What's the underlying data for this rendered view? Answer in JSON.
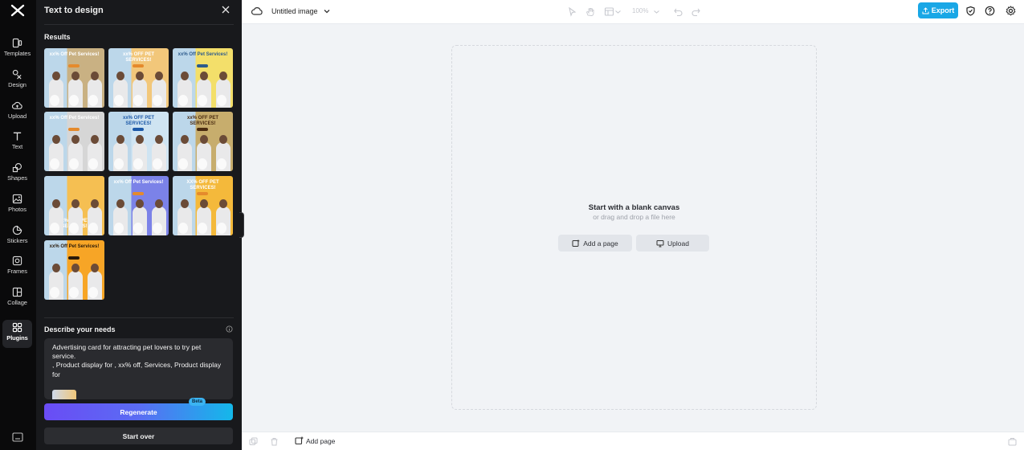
{
  "rail": {
    "items": [
      {
        "label": "Templates",
        "icon": "templates-icon"
      },
      {
        "label": "Design",
        "icon": "design-icon"
      },
      {
        "label": "Upload",
        "icon": "upload-icon"
      },
      {
        "label": "Text",
        "icon": "text-icon"
      },
      {
        "label": "Shapes",
        "icon": "shapes-icon"
      },
      {
        "label": "Photos",
        "icon": "photos-icon"
      },
      {
        "label": "Stickers",
        "icon": "stickers-icon"
      },
      {
        "label": "Frames",
        "icon": "frames-icon"
      },
      {
        "label": "Collage",
        "icon": "collage-icon"
      },
      {
        "label": "Plugins",
        "icon": "plugins-icon",
        "active": true
      }
    ]
  },
  "panel": {
    "title": "Text to design",
    "results_heading": "Results",
    "results": [
      {
        "headline": "xx% Off Pet Services!",
        "bg": "#c9b183",
        "text_color": "#ffffff"
      },
      {
        "headline": "xx% OFF PET SERVICES!",
        "bg": "#f2c77a",
        "text_color": "#ffffff"
      },
      {
        "headline": "xx% Off Pet Services!",
        "bg": "#f3df6a",
        "text_color": "#2d5b8c"
      },
      {
        "headline": "xx% Off Pet Services!",
        "bg": "#d6d6d6",
        "text_color": "#ffffff"
      },
      {
        "headline": "xx% OFF PET SERVICES!",
        "bg": "#cfe4f2",
        "text_color": "#1e5aa8"
      },
      {
        "headline": "xx% OFF PET SERVICES!",
        "bg": "#c7ad6d",
        "text_color": "#4a2b10"
      },
      {
        "headline": "xx% OFF PET SERVICES!",
        "bg": "#f5bf52",
        "text_color": "#ffffff"
      },
      {
        "headline": "xx% Off Pet Services!",
        "bg": "#7b82e8",
        "text_color": "#ffffff"
      },
      {
        "headline": "XX% OFF PET SERVICES!",
        "bg": "#f4b93b",
        "text_color": "#ffffff"
      },
      {
        "headline": "xx% Off Pet Services!",
        "bg": "#f7a526",
        "text_color": "#2a1a0a"
      }
    ],
    "describe_heading": "Describe your needs",
    "prompt_text": "Advertising card for attracting pet lovers to try pet service.\n, Product display for , xx% off, Services, Product display for",
    "beta_label": "Beta",
    "regenerate_label": "Regenerate",
    "start_over_label": "Start over"
  },
  "topbar": {
    "doc_title": "Untitled image",
    "zoom": "100%",
    "export_label": "Export",
    "export_color": "#19a7e6"
  },
  "canvas": {
    "heading": "Start with a blank canvas",
    "subheading": "or drag and drop a file here",
    "add_page_label": "Add a page",
    "upload_label": "Upload"
  },
  "bottombar": {
    "add_page_label": "Add page"
  }
}
